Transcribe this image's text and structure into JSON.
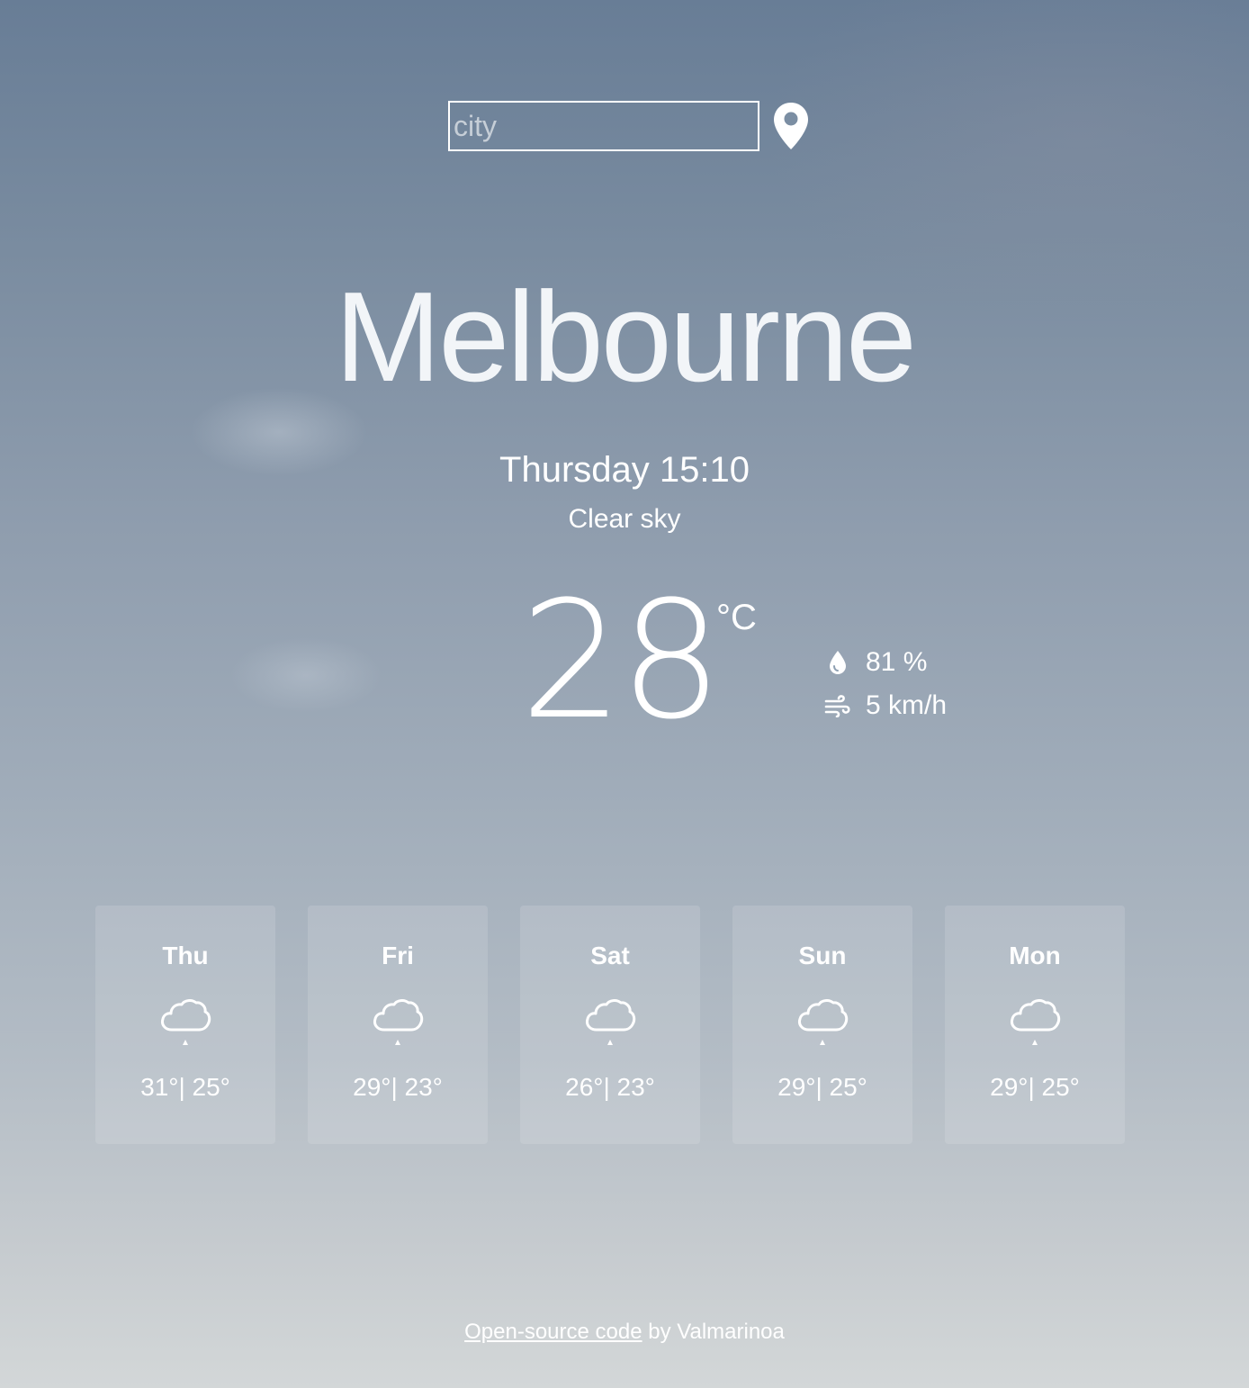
{
  "search": {
    "placeholder": "city",
    "value": ""
  },
  "location_icon": "map-pin-icon",
  "city": "Melbourne",
  "datetime": "Thursday 15:10",
  "condition": "Clear sky",
  "current": {
    "temperature": "28",
    "unit": "°C",
    "humidity": "81 %",
    "wind": "5 km/h",
    "humidity_icon": "droplet-icon",
    "wind_icon": "wind-icon"
  },
  "forecast": [
    {
      "day": "Thu",
      "temps": "31°| 25°",
      "icon": "rain-cloud-icon"
    },
    {
      "day": "Fri",
      "temps": "29°| 23°",
      "icon": "rain-cloud-icon"
    },
    {
      "day": "Sat",
      "temps": "26°| 23°",
      "icon": "rain-cloud-icon"
    },
    {
      "day": "Sun",
      "temps": "29°| 25°",
      "icon": "rain-cloud-icon"
    },
    {
      "day": "Mon",
      "temps": "29°| 25°",
      "icon": "rain-cloud-icon"
    }
  ],
  "footer": {
    "link_text": "Open-source code",
    "suffix": " by Valmarinoa"
  },
  "colors": {
    "text": "#ffffff",
    "sky_top": "#687d96",
    "sky_bottom": "#d3d7d8"
  }
}
